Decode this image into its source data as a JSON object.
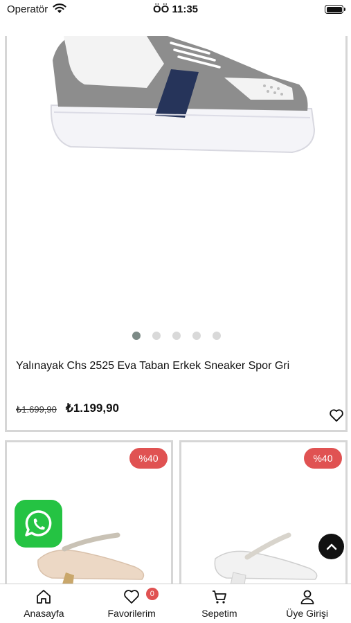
{
  "status_bar": {
    "carrier": "Operatör",
    "time": "ÖÖ 11:35"
  },
  "hero_product": {
    "name": "Yalınayak Chs 2525 Eva Taban Erkek Sneaker Spor Gri",
    "old_price": "₺1.699,90",
    "new_price": "₺1.199,90",
    "carousel": {
      "total": 5,
      "active_index": 0
    }
  },
  "products": [
    {
      "discount": "%40"
    },
    {
      "discount": "%40"
    }
  ],
  "tab_bar": {
    "items": [
      {
        "label": "Anasayfa",
        "icon": "home-icon"
      },
      {
        "label": "Favorilerim",
        "icon": "heart-icon",
        "badge": "0"
      },
      {
        "label": "Sepetim",
        "icon": "cart-icon"
      },
      {
        "label": "Üye Girişi",
        "icon": "user-icon"
      }
    ]
  },
  "colors": {
    "badge": "#e05252",
    "whatsapp": "#25c343",
    "card_border": "#d6d6d6"
  }
}
